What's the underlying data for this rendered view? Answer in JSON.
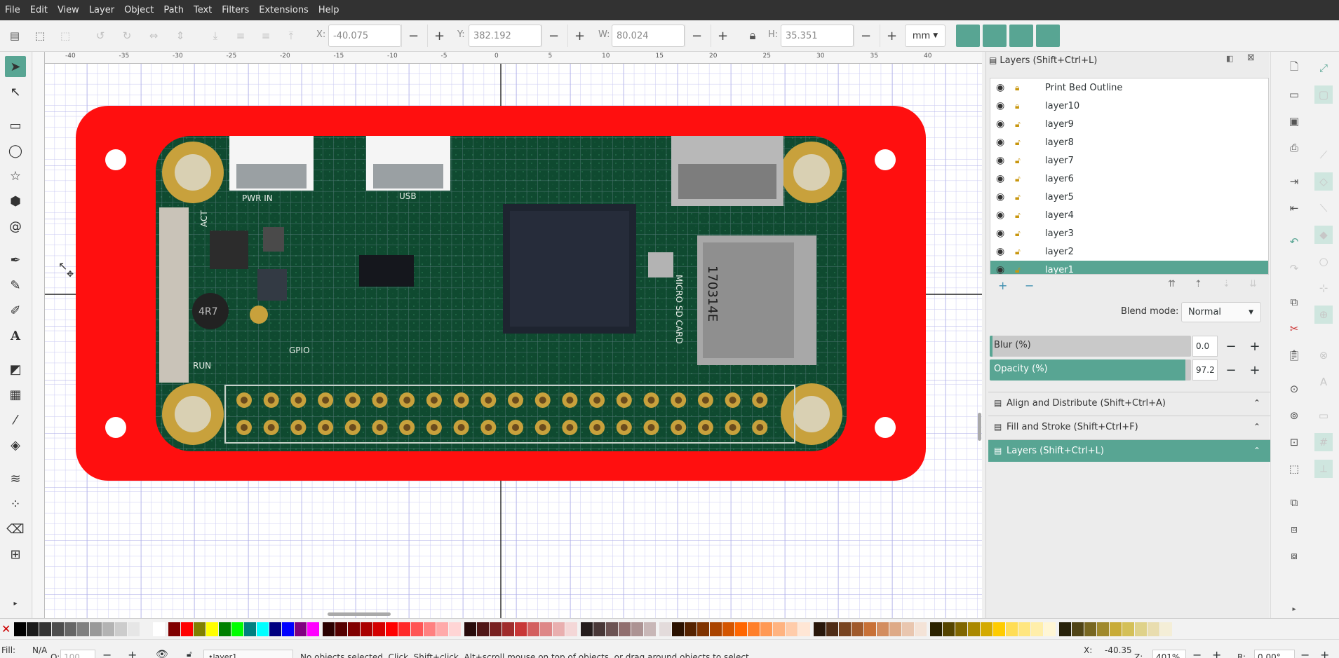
{
  "menu": [
    "File",
    "Edit",
    "View",
    "Layer",
    "Object",
    "Path",
    "Text",
    "Filters",
    "Extensions",
    "Help"
  ],
  "toolbar": {
    "x_label": "X:",
    "x_value": "-40.075",
    "y_label": "Y:",
    "y_value": "382.192",
    "w_label": "W:",
    "w_value": "80.024",
    "h_label": "H:",
    "h_value": "35.351",
    "units": "mm",
    "minus": "−",
    "plus": "+"
  },
  "ruler": {
    "h_ticks": [
      "-40",
      "-35",
      "-30",
      "-25",
      "-20",
      "-15",
      "-10",
      "-5",
      "0",
      "5",
      "10",
      "15",
      "20",
      "25",
      "30",
      "35",
      "40"
    ]
  },
  "layers_panel": {
    "title": "Layers (Shift+Ctrl+L)",
    "layers": [
      {
        "name": "Print Bed Outline",
        "locked": true
      },
      {
        "name": "layer10",
        "locked": true
      },
      {
        "name": "layer9",
        "locked": false
      },
      {
        "name": "layer8",
        "locked": false
      },
      {
        "name": "layer7",
        "locked": false
      },
      {
        "name": "layer6",
        "locked": false
      },
      {
        "name": "layer5",
        "locked": false
      },
      {
        "name": "layer4",
        "locked": false
      },
      {
        "name": "layer3",
        "locked": false
      },
      {
        "name": "layer2",
        "locked": false
      },
      {
        "name": "layer1",
        "locked": false,
        "selected": true
      }
    ],
    "blend_label": "Blend mode:",
    "blend_value": "Normal",
    "blur_label": "Blur (%)",
    "blur_value": "0.0",
    "blur_fraction": 0.0,
    "opacity_label": "Opacity (%)",
    "opacity_value": "97.2",
    "opacity_fraction": 0.972
  },
  "sections": [
    {
      "label": "Align and Distribute (Shift+Ctrl+A)",
      "active": false
    },
    {
      "label": "Fill and Stroke (Shift+Ctrl+F)",
      "active": false
    },
    {
      "label": "Layers (Shift+Ctrl+L)",
      "active": true
    }
  ],
  "status": {
    "fill_label": "Fill:",
    "fill_value": "N/A",
    "o_label": "O:",
    "opacity_value": "100",
    "current_layer": "•layer1",
    "message": "No objects selected. Click, Shift+click, Alt+scroll mouse on top of objects, or drag around objects to select.",
    "cursor_x_label": "X:",
    "cursor_x": "-40.35",
    "zoom_label": "Z:",
    "zoom": "401%",
    "rot_label": "R:",
    "rotation": "0.00°"
  },
  "board": {
    "labels": [
      "PWR IN",
      "USB",
      "ACT",
      "RUN",
      "GPIO",
      "MICRO SD CARD",
      "170314E",
      "4R7"
    ]
  },
  "colors": {
    "accent": "#58a593",
    "plate": "#ff0f0f",
    "pcb": "#0f4a30",
    "menubar": "#323232"
  },
  "palette": [
    "#000000",
    "#1a1a1a",
    "#333333",
    "#4d4d4d",
    "#666666",
    "#808080",
    "#999999",
    "#b3b3b3",
    "#cccccc",
    "#e6e6e6",
    "#f2f2f2",
    "#ffffff",
    "#800000",
    "#ff0000",
    "#808000",
    "#ffff00",
    "#008000",
    "#00ff00",
    "#008080",
    "#00ffff",
    "#000080",
    "#0000ff",
    "#800080",
    "#ff00ff",
    "#2b0000",
    "#550000",
    "#800000",
    "#aa0000",
    "#d40000",
    "#ff0000",
    "#ff2a2a",
    "#ff5555",
    "#ff8080",
    "#ffaaaa",
    "#ffd5d5",
    "#280b0b",
    "#501616",
    "#782121",
    "#a02c2c",
    "#c83737",
    "#d35f5f",
    "#de8787",
    "#e9afaf",
    "#f4d7d7",
    "#241c1c",
    "#483737",
    "#6c5353",
    "#916f6f",
    "#ac9393",
    "#c8b7b7",
    "#e3dbdb",
    "#2b1100",
    "#552200",
    "#803300",
    "#aa4400",
    "#d45500",
    "#ff6600",
    "#ff7f2a",
    "#ff9955",
    "#ffb380",
    "#ffccaa",
    "#ffe6d5",
    "#28170b",
    "#502d16",
    "#784421",
    "#a05a2c",
    "#c87137",
    "#d38d5f",
    "#deaa87",
    "#e9c6af",
    "#f4e3d7",
    "#2b2200",
    "#554400",
    "#806600",
    "#aa8800",
    "#d4aa00",
    "#ffcc00",
    "#ffdd55",
    "#ffe680",
    "#ffeeaa",
    "#fff6d5",
    "#28220b",
    "#504416",
    "#786721",
    "#a0892c",
    "#c8ab37",
    "#d4c058",
    "#dfd28a",
    "#e9ddaf",
    "#f4eed7"
  ]
}
